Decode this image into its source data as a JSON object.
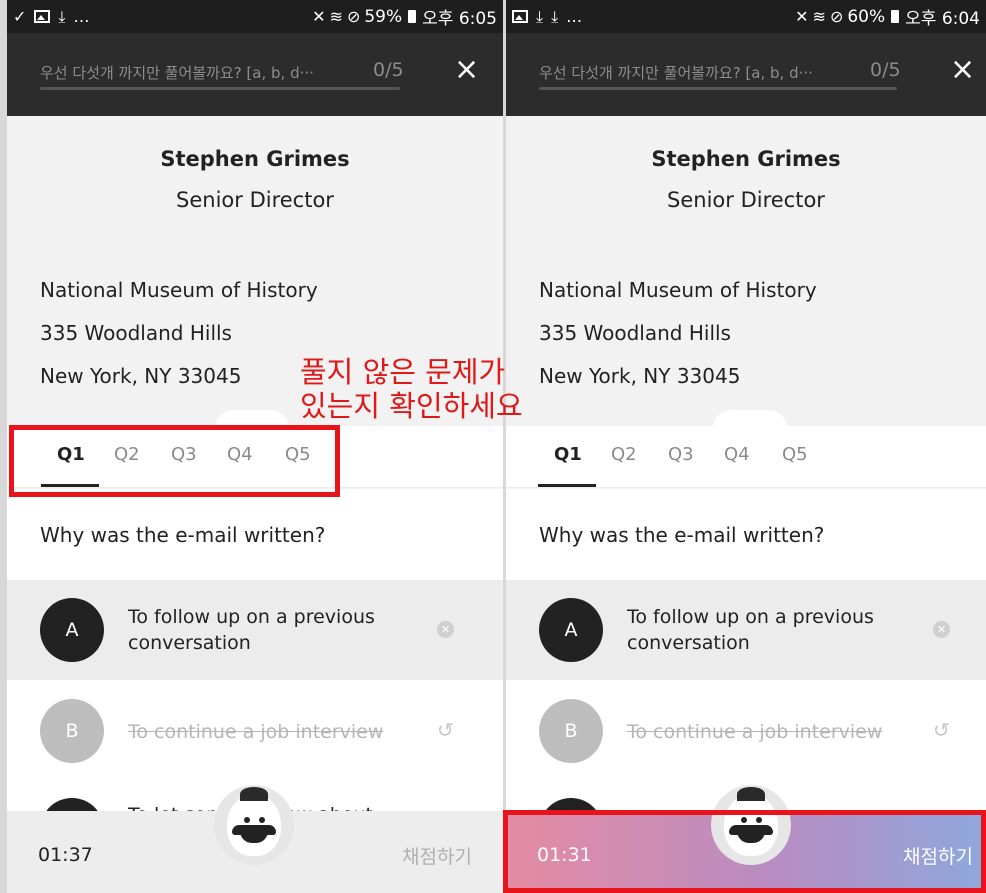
{
  "annotation": {
    "text_line1": "풀지 않은 문제가",
    "text_line2": "있는지 확인하세요",
    "color": "#e01818"
  },
  "left": {
    "status": {
      "time": "오후 6:05",
      "battery": "59%"
    },
    "header": {
      "prompt": "우선 다섯개 까지만 풀어볼까요? [a, b, d···",
      "count": "0/5",
      "close_icon": "×"
    },
    "person": {
      "name": "Stephen Grimes",
      "title": "Senior Director"
    },
    "address": [
      "National Museum of History",
      "335 Woodland Hills",
      "New York, NY 33045"
    ],
    "tabs": [
      "Q1",
      "Q2",
      "Q3",
      "Q4",
      "Q5"
    ],
    "question": "Why was the e-mail written?",
    "options": [
      {
        "letter": "A",
        "text_line1": "To follow up on a previous",
        "text_line2": "conversation"
      },
      {
        "letter": "B",
        "text": "To continue a job interview"
      },
      {
        "letter": "",
        "text": "To let som          ow about"
      }
    ],
    "timer": "01:37",
    "grade_label": "채점하기"
  },
  "right": {
    "status": {
      "time": "오후 6:04",
      "battery": "60%"
    },
    "header": {
      "prompt": "우선 다섯개 까지만 풀어볼까요? [a, b, d···",
      "count": "0/5",
      "close_icon": "×"
    },
    "person": {
      "name": "Stephen Grimes",
      "title": "Senior Director"
    },
    "address": [
      "National Museum of History",
      "335 Woodland Hills",
      "New York, NY 33045"
    ],
    "tabs": [
      "Q1",
      "Q2",
      "Q3",
      "Q4",
      "Q5"
    ],
    "question": "Why was the e-mail written?",
    "options": [
      {
        "letter": "A",
        "text_line1": "To follow up on a previous",
        "text_line2": "conversation"
      },
      {
        "letter": "B",
        "text": "To continue a job interview"
      }
    ],
    "timer": "01:31",
    "grade_label": "채점하기",
    "gradient_colors": [
      "#e58ba3",
      "#8ea8dd"
    ]
  }
}
